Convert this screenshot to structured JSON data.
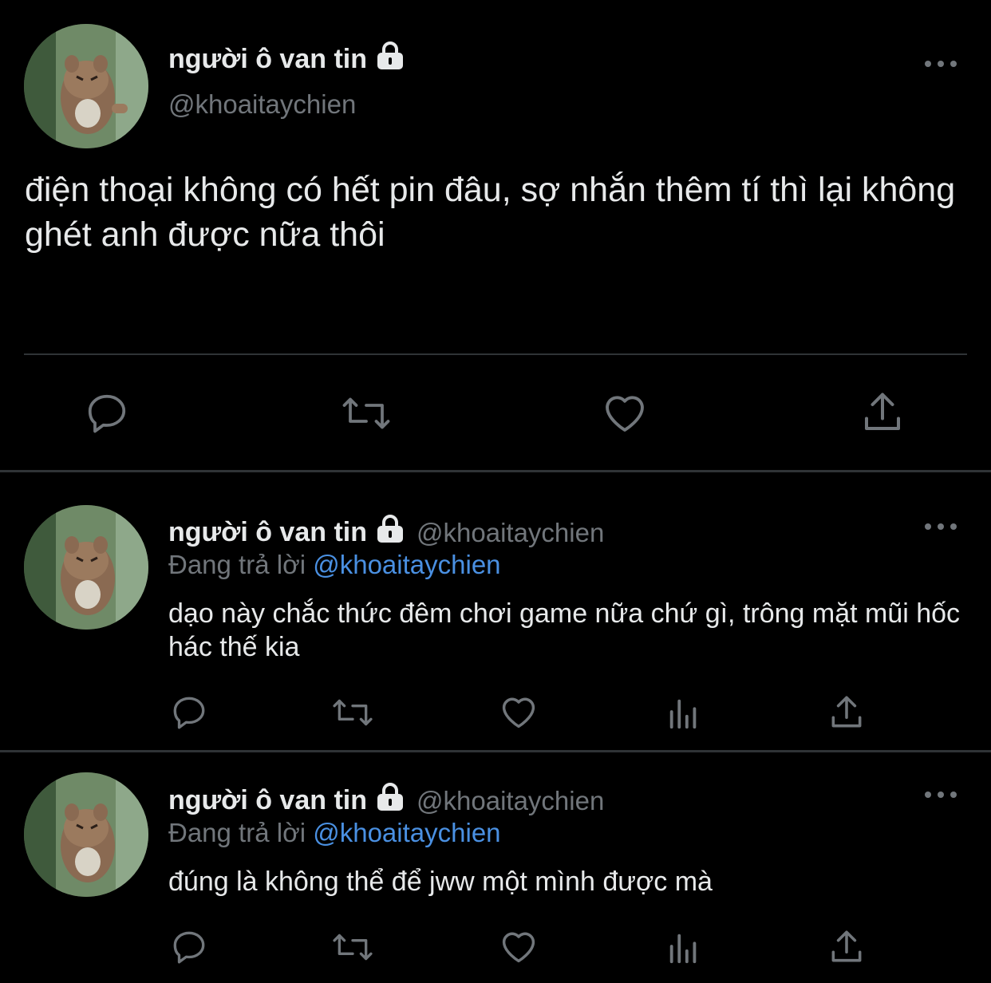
{
  "main_tweet": {
    "display_name": "người ô van tin",
    "handle": "@khoaitaychien",
    "text": "điện thoại không có hết pin đâu, sợ nhắn thêm tí thì lại không ghét anh được nữa thôi",
    "icons": [
      "reply-icon",
      "retweet-icon",
      "like-icon",
      "share-icon"
    ]
  },
  "replies": [
    {
      "display_name": "người ô van tin",
      "handle": "@khoaitaychien",
      "replying_prefix": "Đang trả lời",
      "replying_to": "@khoaitaychien",
      "text": "dạo này chắc thức đêm chơi game nữa chứ gì, trông mặt mũi hốc hác thế kia",
      "icons": [
        "reply-icon",
        "retweet-icon",
        "like-icon",
        "analytics-icon",
        "share-icon"
      ]
    },
    {
      "display_name": "người ô van tin",
      "handle": "@khoaitaychien",
      "replying_prefix": "Đang trả lời",
      "replying_to": "@khoaitaychien",
      "text": "đúng là không thể để jww một mình được mà",
      "icons": [
        "reply-icon",
        "retweet-icon",
        "like-icon",
        "analytics-icon",
        "share-icon"
      ]
    }
  ],
  "colors": {
    "background": "#000000",
    "text": "#e7e9ea",
    "secondary": "#71767b",
    "mention": "#4a90e2",
    "divider": "#2f3336"
  }
}
